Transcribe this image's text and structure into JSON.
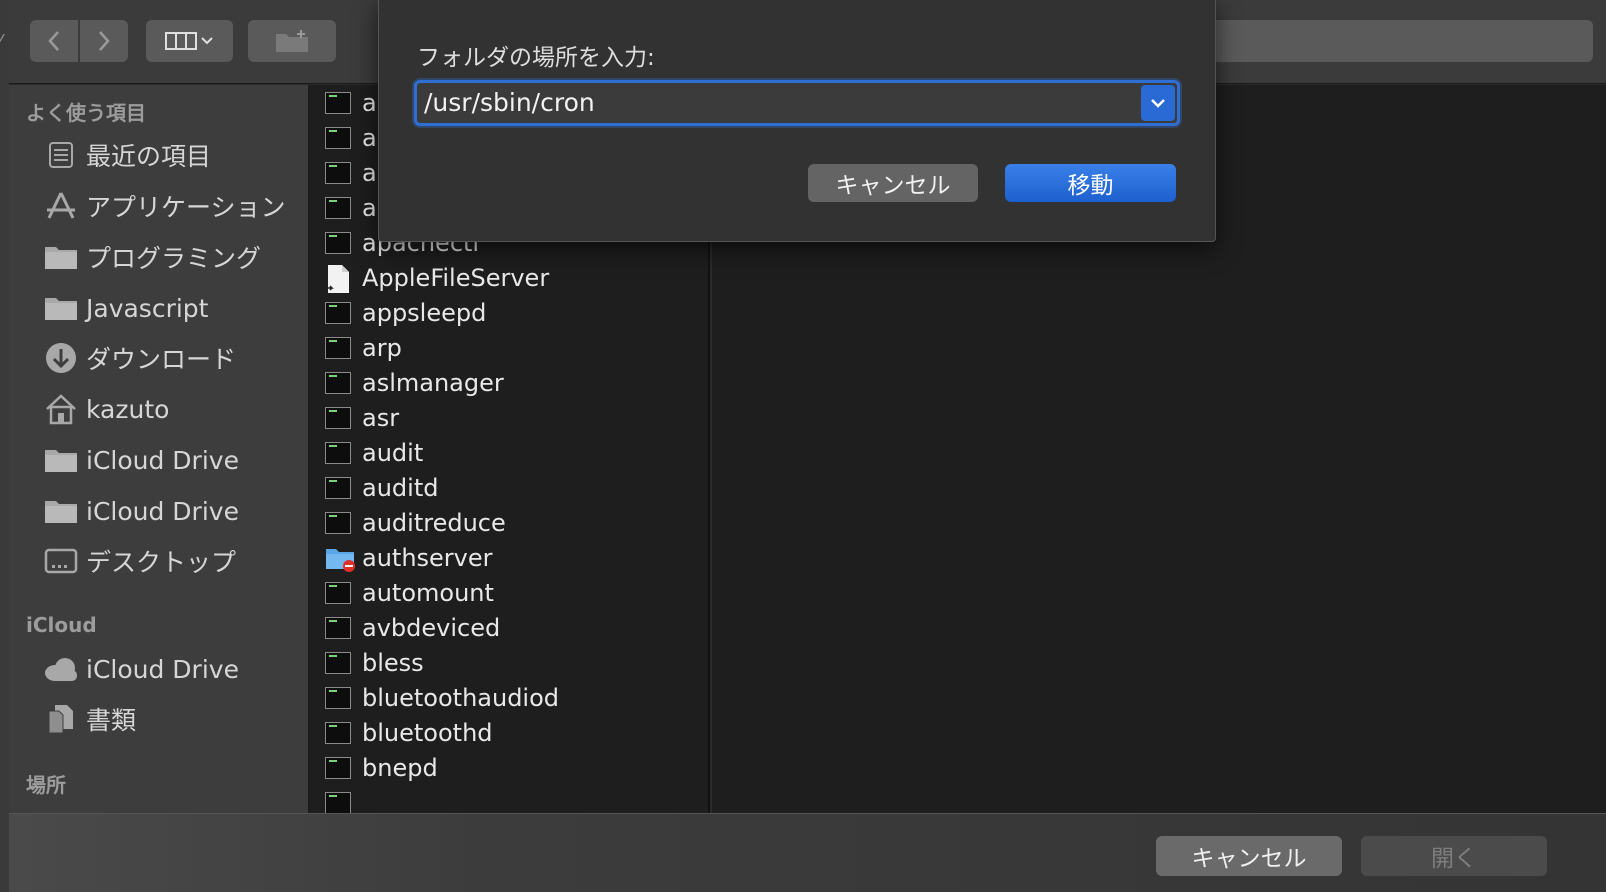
{
  "sheet": {
    "title": "フォルダの場所を入力:",
    "path_value": "/usr/sbin/cron",
    "cancel_label": "キャンセル",
    "move_label": "移動"
  },
  "sidebar": {
    "favorites_heading": "よく使う項目",
    "favorites": [
      {
        "label": "最近の項目",
        "icon": "recents-icon"
      },
      {
        "label": "アプリケーション",
        "icon": "applications-icon"
      },
      {
        "label": "プログラミング",
        "icon": "folder-icon"
      },
      {
        "label": "Javascript",
        "icon": "folder-icon"
      },
      {
        "label": "ダウンロード",
        "icon": "downloads-icon"
      },
      {
        "label": "kazuto",
        "icon": "home-icon"
      },
      {
        "label": "iCloud Drive",
        "icon": "folder-icon"
      },
      {
        "label": "iCloud Drive",
        "icon": "folder-icon"
      },
      {
        "label": "デスクトップ",
        "icon": "desktop-icon"
      }
    ],
    "icloud_heading": "iCloud",
    "icloud": [
      {
        "label": "iCloud Drive",
        "icon": "cloud-icon"
      },
      {
        "label": "書類",
        "icon": "documents-icon"
      }
    ],
    "locations_heading": "場所"
  },
  "files": [
    {
      "name": "a",
      "icon": "executable-icon"
    },
    {
      "name": "ac",
      "icon": "executable-icon"
    },
    {
      "name": "ac",
      "icon": "executable-icon"
    },
    {
      "name": "ar",
      "icon": "executable-icon"
    },
    {
      "name": "apachectl",
      "icon": "executable-icon"
    },
    {
      "name": "AppleFileServer",
      "icon": "alias-document-icon"
    },
    {
      "name": "appsleepd",
      "icon": "executable-icon"
    },
    {
      "name": "arp",
      "icon": "executable-icon"
    },
    {
      "name": "aslmanager",
      "icon": "executable-icon"
    },
    {
      "name": "asr",
      "icon": "executable-icon"
    },
    {
      "name": "audit",
      "icon": "executable-icon"
    },
    {
      "name": "auditd",
      "icon": "executable-icon"
    },
    {
      "name": "auditreduce",
      "icon": "executable-icon"
    },
    {
      "name": "authserver",
      "icon": "restricted-folder-icon"
    },
    {
      "name": "automount",
      "icon": "executable-icon"
    },
    {
      "name": "avbdeviced",
      "icon": "executable-icon"
    },
    {
      "name": "bless",
      "icon": "executable-icon"
    },
    {
      "name": "bluetoothaudiod",
      "icon": "executable-icon"
    },
    {
      "name": "bluetoothd",
      "icon": "executable-icon"
    },
    {
      "name": "bnepd",
      "icon": "executable-icon"
    }
  ],
  "footer": {
    "cancel_label": "キャンセル",
    "open_label": "開く"
  },
  "colors": {
    "accent": "#2f6fd3",
    "window_bg": "#2b2b2b",
    "sidebar_bg": "#3d3d3d",
    "list_bg": "#1e1e1e"
  }
}
